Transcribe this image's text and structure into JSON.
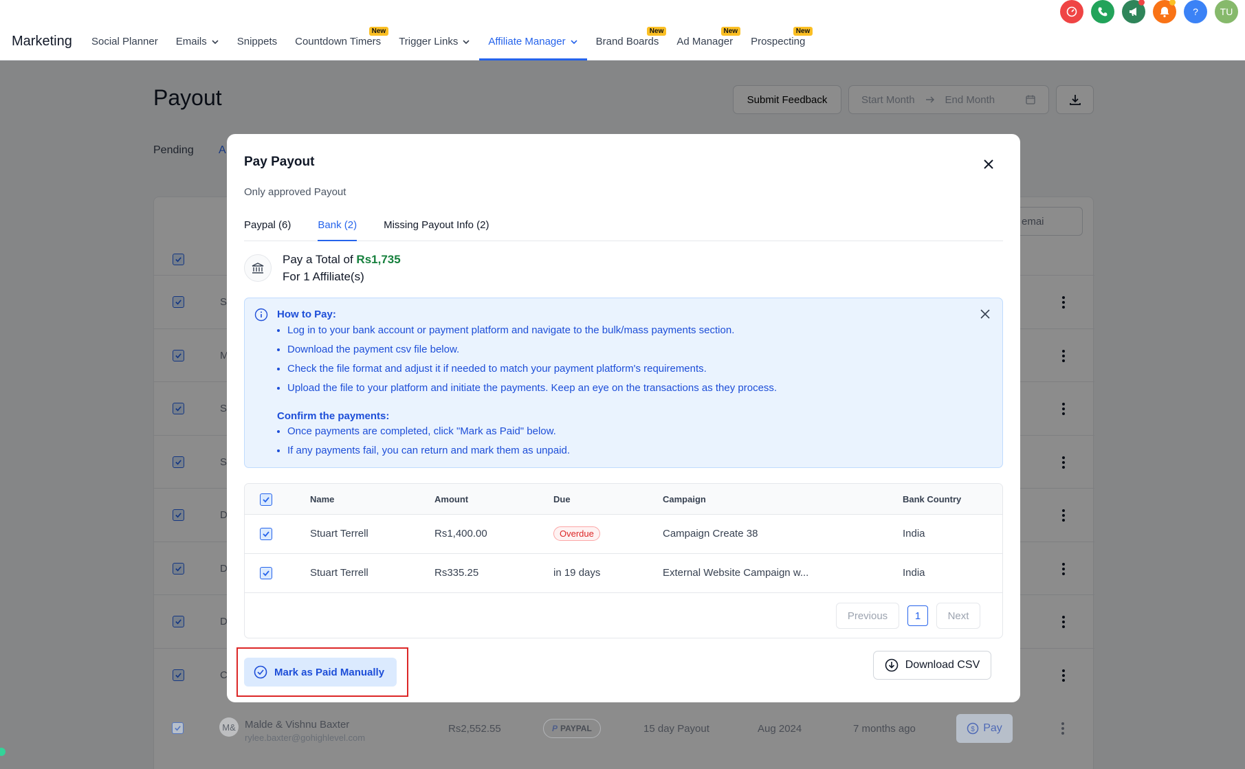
{
  "header": {
    "brand": "Marketing",
    "nav": [
      {
        "label": "Social Planner",
        "chevron": false,
        "new": false,
        "active": false
      },
      {
        "label": "Emails",
        "chevron": true,
        "new": false,
        "active": false
      },
      {
        "label": "Snippets",
        "chevron": false,
        "new": false,
        "active": false
      },
      {
        "label": "Countdown Timers",
        "chevron": false,
        "new": true,
        "active": false
      },
      {
        "label": "Trigger Links",
        "chevron": true,
        "new": false,
        "active": false
      },
      {
        "label": "Affiliate Manager",
        "chevron": true,
        "new": false,
        "active": true
      },
      {
        "label": "Brand Boards",
        "chevron": false,
        "new": true,
        "active": false
      },
      {
        "label": "Ad Manager",
        "chevron": false,
        "new": true,
        "active": false
      },
      {
        "label": "Prospecting",
        "chevron": false,
        "new": true,
        "active": false
      }
    ],
    "new_badge": "New",
    "top_icons": [
      {
        "name": "gauge-icon",
        "color": "#ef4444"
      },
      {
        "name": "phone-icon",
        "color": "#22a35a"
      },
      {
        "name": "megaphone-icon",
        "color": "#2f855a"
      },
      {
        "name": "bell-icon",
        "color": "#f97316"
      },
      {
        "name": "help-icon",
        "color": "#3b82f6"
      }
    ],
    "avatar_initials": "TU",
    "avatar_color": "#86b96b"
  },
  "page": {
    "title": "Payout",
    "submit_feedback": "Submit Feedback",
    "start_month": "Start Month",
    "end_month": "End Month",
    "tab_pending": "Pending",
    "tab_approved_partial": "A",
    "search_partial": "emai"
  },
  "background_rows": {
    "initials": [
      "S",
      "M",
      "S",
      "S",
      "D",
      "D",
      "D",
      "C"
    ],
    "last_row": {
      "initials": "M&",
      "name": "Malde & Vishnu Baxter",
      "email": "rylee.baxter@gohighlevel.com",
      "amount": "Rs2,552.55",
      "method": "PAYPAL",
      "schedule": "15 day Payout",
      "month": "Aug 2024",
      "ago": "7 months ago",
      "pay_label": "Pay"
    }
  },
  "modal": {
    "title": "Pay Payout",
    "subtitle": "Only approved Payout",
    "tabs": [
      {
        "label": "Paypal (6)",
        "active": false
      },
      {
        "label": "Bank (2)",
        "active": true
      },
      {
        "label": "Missing Payout Info (2)",
        "active": false
      }
    ],
    "total_prefix": "Pay a Total of ",
    "total_amount": "Rs1,735",
    "total_affiliates": "For 1 Affiliate(s)",
    "howto": {
      "heading": "How to Pay:",
      "steps": [
        "Log in to your bank account or payment platform and navigate to the bulk/mass payments section.",
        "Download the payment csv file below.",
        "Check the file format and adjust it if needed to match your payment platform's requirements.",
        "Upload the file to your platform and initiate the payments. Keep an eye on the transactions as they process."
      ],
      "confirm_heading": "Confirm the payments:",
      "confirm_steps": [
        "Once payments are completed, click \"Mark as Paid\" below.",
        "If any payments fail, you can return and mark them as unpaid."
      ]
    },
    "table": {
      "columns": [
        "Name",
        "Amount",
        "Due",
        "Campaign",
        "Bank Country"
      ],
      "rows": [
        {
          "name": "Stuart Terrell",
          "amount": "Rs1,400.00",
          "due": "Overdue",
          "overdue": true,
          "campaign": "Campaign Create 38",
          "country": "India"
        },
        {
          "name": "Stuart Terrell",
          "amount": "Rs335.25",
          "due": "in 19 days",
          "overdue": false,
          "campaign": "External Website Campaign w...",
          "country": "India"
        }
      ],
      "prev": "Previous",
      "page": "1",
      "next": "Next"
    },
    "mark_paid": "Mark as Paid Manually",
    "download_csv": "Download CSV"
  }
}
